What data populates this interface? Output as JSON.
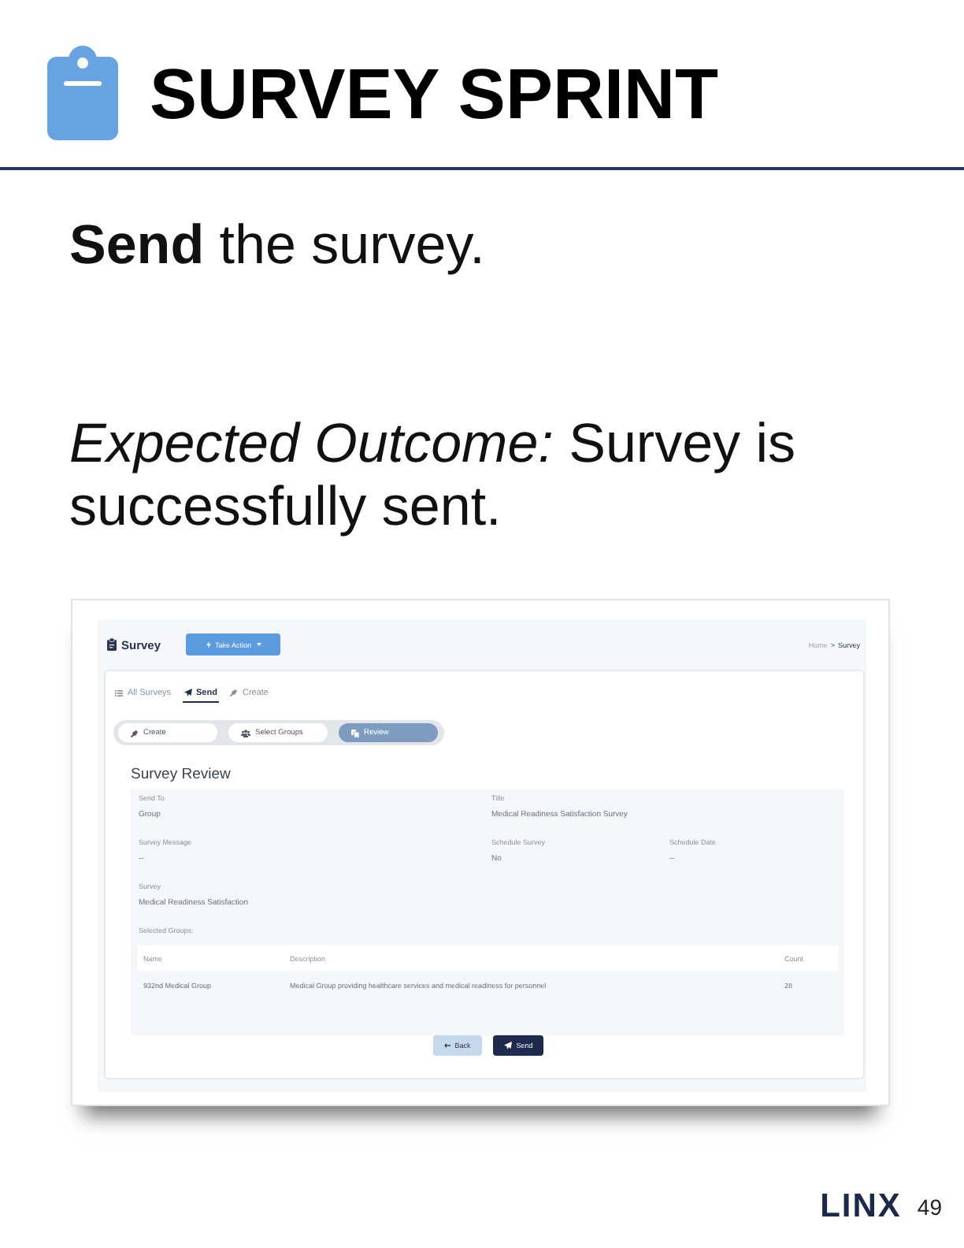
{
  "header": {
    "title": "SURVEY SPRINT"
  },
  "instructions": [
    "**Send** the survey.",
    "*Expected Outcome:* Survey is successfully sent."
  ],
  "screenshot": {
    "app_bar": {
      "title": "Survey",
      "action_button": "Take Action",
      "breadcrumb": {
        "separator": ">",
        "items": [
          {
            "label": "Home",
            "current": false
          },
          {
            "label": "Survey",
            "current": true
          }
        ]
      }
    },
    "tabs": [
      {
        "label": "All Surveys",
        "selected": false
      },
      {
        "label": "Send",
        "selected": true
      },
      {
        "label": "Create",
        "selected": false
      }
    ],
    "steps": [
      {
        "label": "Create",
        "selected": false
      },
      {
        "label": "Select Groups",
        "selected": false
      },
      {
        "label": "Review",
        "selected": true
      }
    ],
    "review": {
      "heading": "Survey Review",
      "field_rows": [
        [
          {
            "label": "Send To",
            "value": "Group"
          },
          {
            "label": "Title",
            "value": "Medical Readiness Satisfaction Survey"
          }
        ],
        [
          {
            "label": "Survey Message",
            "value": "--"
          },
          {
            "label": "Schedule Survey",
            "value": "No"
          },
          {
            "label": "Schedule Date",
            "value": "--"
          }
        ],
        [
          {
            "label": "Survey",
            "value": "Medical Readiness Satisfaction"
          }
        ]
      ],
      "selected_groups": {
        "label": "Selected Groups:",
        "columns": [
          "Name",
          "Description",
          "Count"
        ],
        "rows": [
          [
            "932nd Medical Group",
            "Medical Group providing healthcare services and medical readiness for personnel",
            "28"
          ]
        ]
      }
    },
    "buttons": [
      {
        "label": "Back",
        "kind": "secondary"
      },
      {
        "label": "Send",
        "kind": "primary"
      }
    ]
  },
  "footer": {
    "logo": "LINX",
    "page_number": "49"
  }
}
